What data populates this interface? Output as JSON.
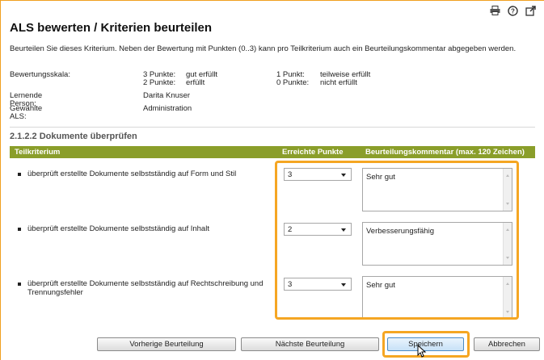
{
  "toolbar": {
    "icons": [
      "print-icon",
      "help-icon",
      "external-link-icon"
    ]
  },
  "page": {
    "title": "ALS bewerten / Kriterien beurteilen",
    "intro": "Beurteilen Sie dieses Kriterium. Neben der Bewertung mit Punkten (0..3) kann pro Teilkriterium auch ein Beurteilungskommentar abgegeben werden."
  },
  "meta": {
    "scale_label": "Bewertungsskala:",
    "scale": [
      {
        "points": "3 Punkte:",
        "text": "gut erfüllt"
      },
      {
        "points": "2 Punkte:",
        "text": "erfüllt"
      },
      {
        "points": "1 Punkt:",
        "text": "teilweise erfüllt"
      },
      {
        "points": "0 Punkte:",
        "text": "nicht erfüllt"
      }
    ],
    "learner_label": "Lernende Person:",
    "learner_value": "Darita Knuser",
    "als_label": "Gewählte ALS:",
    "als_value": "Administration"
  },
  "section": {
    "title": "2.1.2.2 Dokumente überprüfen",
    "headers": {
      "criterion": "Teilkriterium",
      "points": "Erreichte Punkte",
      "comment": "Beurteilungskommentar (max. 120 Zeichen)"
    },
    "rows": [
      {
        "criterion": "überprüft erstellte Dokumente selbstständig auf Form und Stil",
        "points": "3",
        "comment": "Sehr gut"
      },
      {
        "criterion": "überprüft erstellte Dokumente selbstständig auf Inhalt",
        "points": "2",
        "comment": "Verbesserungsfähig"
      },
      {
        "criterion": "überprüft erstellte Dokumente selbstständig auf Rechtschreibung und Trennungsfehler",
        "points": "3",
        "comment": "Sehr gut"
      }
    ]
  },
  "buttons": {
    "previous": "Vorherige Beurteilung",
    "next": "Nächste Beurteilung",
    "save": "Speichern",
    "cancel": "Abbrechen"
  },
  "colors": {
    "header_bg": "#8a9e2a",
    "highlight": "#f5a623"
  }
}
